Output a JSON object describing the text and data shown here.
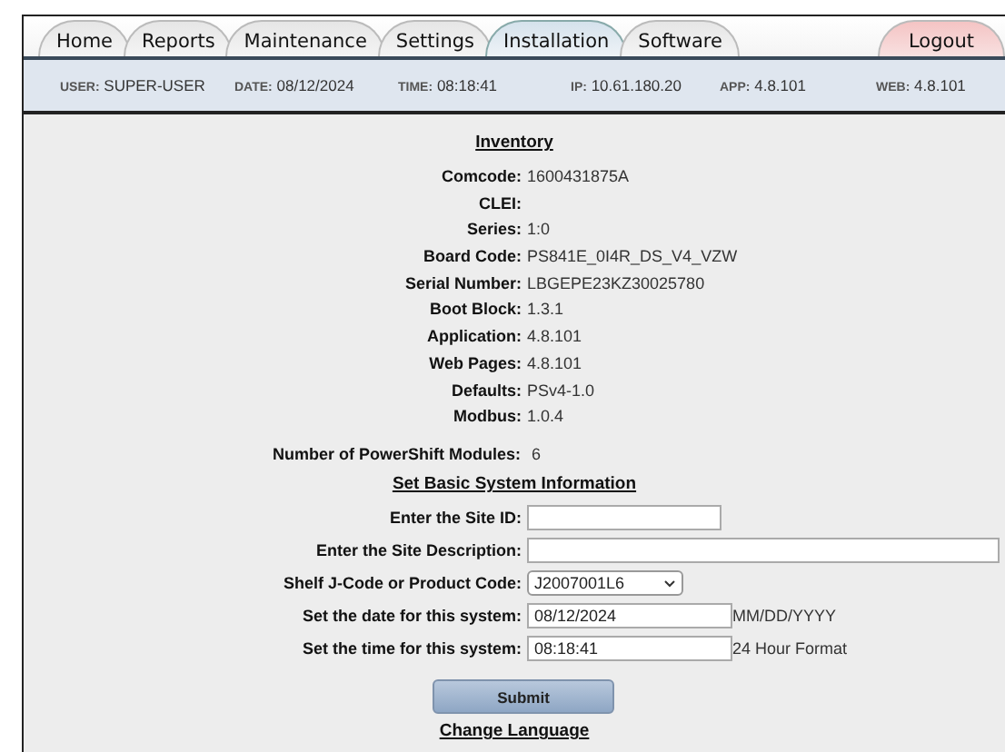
{
  "tabs": [
    {
      "label": "Home",
      "selected": false,
      "kind": "nav"
    },
    {
      "label": "Reports",
      "selected": false,
      "kind": "nav"
    },
    {
      "label": "Maintenance",
      "selected": false,
      "kind": "nav"
    },
    {
      "label": "Settings",
      "selected": false,
      "kind": "nav"
    },
    {
      "label": "Installation",
      "selected": true,
      "kind": "nav"
    },
    {
      "label": "Software",
      "selected": false,
      "kind": "nav"
    },
    {
      "label": "Logout",
      "selected": false,
      "kind": "logout"
    }
  ],
  "info_bar": [
    {
      "label": "USER:",
      "value": "SUPER-USER"
    },
    {
      "label": "DATE:",
      "value": "08/12/2024"
    },
    {
      "label": "TIME:",
      "value": "08:18:41"
    },
    {
      "label": "IP:",
      "value": "10.61.180.20"
    },
    {
      "label": "APP:",
      "value": "4.8.101"
    },
    {
      "label": "WEB:",
      "value": "4.8.101"
    }
  ],
  "inventory": {
    "title": "Inventory",
    "rows": [
      {
        "label": "Comcode:",
        "value": "1600431875A"
      },
      {
        "label": "CLEI:"
      },
      {
        "label": "Series:",
        "value": "1:0"
      },
      {
        "label": "Board Code:",
        "value": "PS841E_0I4R_DS_V4_VZW"
      },
      {
        "label": "Serial Number:",
        "value": "LBGEPE23KZ30025780"
      },
      {
        "label": "Boot Block:",
        "value": "1.3.1"
      },
      {
        "label": "Application:",
        "value": "4.8.101"
      },
      {
        "label": "Web Pages:",
        "value": "4.8.101"
      },
      {
        "label": "Defaults:",
        "value": "PSv4-1.0"
      },
      {
        "label": "Modbus:",
        "value": "1.0.4"
      }
    ]
  },
  "modules": {
    "label": "Number of PowerShift Modules:",
    "value": "6"
  },
  "system_info": {
    "title": "Set Basic System Information",
    "fields": [
      {
        "kind": "text",
        "label": "Enter the Site ID:"
      },
      {
        "kind": "text",
        "label": "Enter the Site Description:"
      },
      {
        "kind": "select",
        "label": "Shelf J-Code or Product Code:",
        "value": "J2007001L6"
      },
      {
        "kind": "text",
        "label": "Set the date for this system:",
        "value": "08/12/2024",
        "hint": "MM/DD/YYYY"
      },
      {
        "kind": "text",
        "label": "Set the time for this system:",
        "value": "08:18:41",
        "hint": "24 Hour Format"
      }
    ],
    "submit": "Submit"
  },
  "change_language": {
    "title": "Change Language"
  }
}
